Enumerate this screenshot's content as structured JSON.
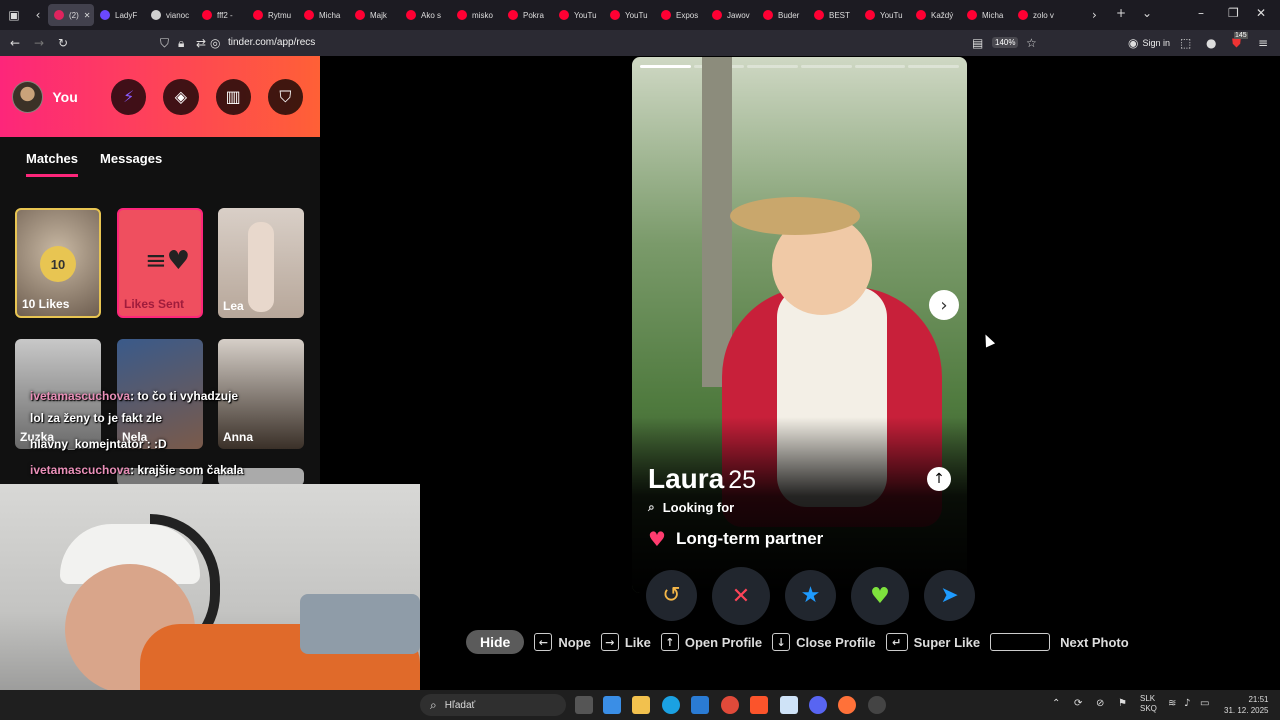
{
  "browser": {
    "tabs": [
      {
        "label": "(2)",
        "color": "#e0245e",
        "active": true
      },
      {
        "label": "LadyF",
        "color": "#6b48ff"
      },
      {
        "label": "vianoc",
        "color": "#d0d0d0"
      },
      {
        "label": "fff2 -",
        "color": "#ff0033"
      },
      {
        "label": "Rytmu",
        "color": "#ff0033"
      },
      {
        "label": "Micha",
        "color": "#ff0033"
      },
      {
        "label": "Majk ",
        "color": "#ff0033"
      },
      {
        "label": "Ako s",
        "color": "#ff0033"
      },
      {
        "label": "misko",
        "color": "#ff0033"
      },
      {
        "label": "Pokra",
        "color": "#ff0033"
      },
      {
        "label": "YouTu",
        "color": "#ff0033"
      },
      {
        "label": "YouTu",
        "color": "#ff0033"
      },
      {
        "label": "Expos",
        "color": "#ff0033"
      },
      {
        "label": "Jawov",
        "color": "#ff0033"
      },
      {
        "label": "Buder",
        "color": "#ff0033"
      },
      {
        "label": "BEST",
        "color": "#ff0033"
      },
      {
        "label": "YouTu",
        "color": "#ff0033"
      },
      {
        "label": "Každý",
        "color": "#ff0033"
      },
      {
        "label": "Micha",
        "color": "#ff0033"
      },
      {
        "label": "zolo v",
        "color": "#ff0033"
      }
    ],
    "url": "tinder.com/app/recs",
    "zoom": "140%",
    "sign_in": "Sign in",
    "badge": "145"
  },
  "sidebar": {
    "user": "You",
    "tabs": {
      "matches": "Matches",
      "messages": "Messages"
    },
    "likes_count": "10",
    "likes_label": "10 Likes",
    "likes_sent": "Likes Sent",
    "matches": [
      "Lea",
      "Zuzka",
      "Nela",
      "Anna"
    ]
  },
  "chat": [
    {
      "user": "ivetamascuchova",
      "text": ": to čo ti vyhadzuje"
    },
    {
      "user": "",
      "text": "lol za ženy to je fakt zle"
    },
    {
      "user": "hlavny_komejntator",
      "text": " : :D"
    },
    {
      "user": "ivetamascuchova",
      "text": ": krajšie som čakala"
    }
  ],
  "profile": {
    "name": "Laura",
    "age": "25",
    "looking_for_label": "Looking for",
    "looking_for_value": "Long-term partner",
    "photo_count": 6,
    "current_photo": 1
  },
  "actions": {
    "rewind": "↺",
    "nope": "✕",
    "super_like": "★",
    "like": "♥",
    "boost": "➤"
  },
  "hints": {
    "hide": "Hide",
    "nope": "Nope",
    "like": "Like",
    "open_profile": "Open Profile",
    "close_profile": "Close Profile",
    "super_like": "Super Like",
    "next_photo": "Next Photo"
  },
  "taskbar": {
    "search_placeholder": "Hľadať",
    "lang_line1": "SLK",
    "lang_line2": "SKQ",
    "time": "21:51",
    "date": "31. 12. 2025"
  }
}
